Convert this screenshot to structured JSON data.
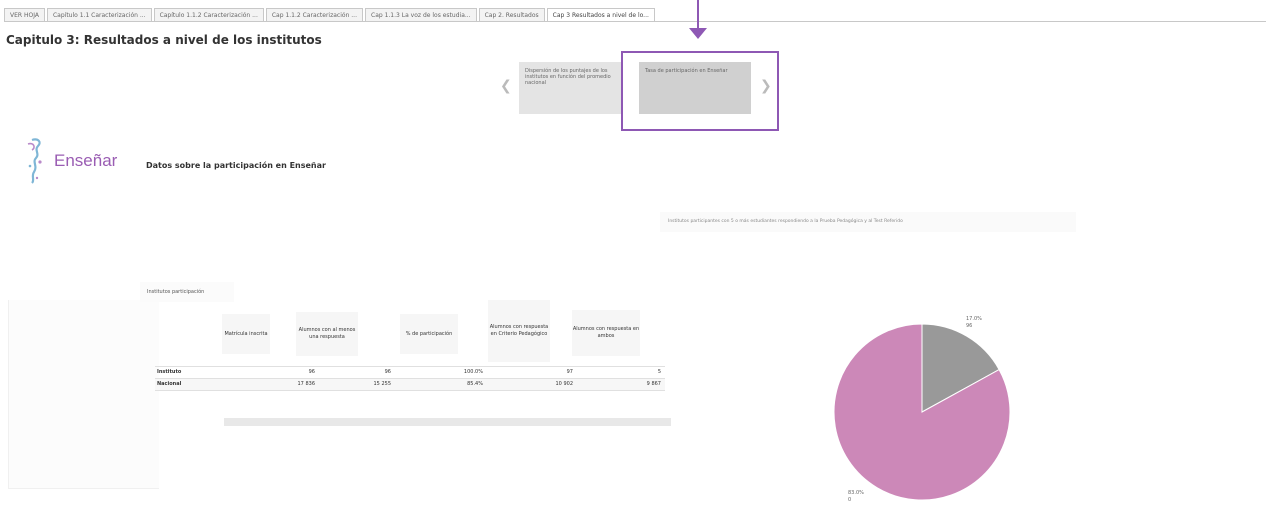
{
  "tabs": [
    {
      "label": "VER HOJA"
    },
    {
      "label": "Capítulo 1.1 Caracterización ..."
    },
    {
      "label": "Capítulo 1.1.2 Caracterización ..."
    },
    {
      "label": "Cap 1.1.2 Caracterización ..."
    },
    {
      "label": "Cap 1.1.3 La voz de los estudia..."
    },
    {
      "label": "Cap 2. Resultados"
    },
    {
      "label": "Cap 3 Resultados a nivel de lo..."
    }
  ],
  "page_title": "Capitulo 3: Resultados a nivel de los institutos",
  "carousel": {
    "card1": "Dispersión de los puntajes de los institutos en función del promedio nacional",
    "card2": "Tasa de participación en Enseñar",
    "prev_icon": "chevron-left-icon",
    "next_icon": "chevron-right-icon"
  },
  "logo": {
    "text": "Enseñar"
  },
  "section_title": "Datos sobre la participación en Enseñar",
  "pie_subtitle": "Institutos participantes con 5 o más estudiantes respondiendo a la Prueba Pedagógica y al Test Referido",
  "table_caption": "Institutos participación",
  "table": {
    "columns": [
      "Matrícula inscrita",
      "Alumnos con al menos una respuesta",
      "% de participación",
      "Alumnos con respuesta en Criterio Pedagógico",
      "Alumnos con respuesta en ambos"
    ],
    "rows": [
      {
        "label": "Instituto",
        "cells": [
          "96",
          "96",
          "100.0%",
          "97",
          "5"
        ]
      },
      {
        "label": "Nacional",
        "cells": [
          "17 836",
          "15 255",
          "85.4%",
          "10 902",
          "9 867"
        ]
      }
    ]
  },
  "pie": {
    "slices": [
      {
        "value": 17.0,
        "label": "17.0%",
        "sublabel": "96",
        "color": "#999999"
      },
      {
        "value": 83.0,
        "label": "83.0%",
        "sublabel": "0",
        "color": "#cc88b8"
      }
    ]
  },
  "colors": {
    "accent": "#8e58b4",
    "pie_pink": "#cc88b8",
    "pie_gray": "#999999"
  }
}
